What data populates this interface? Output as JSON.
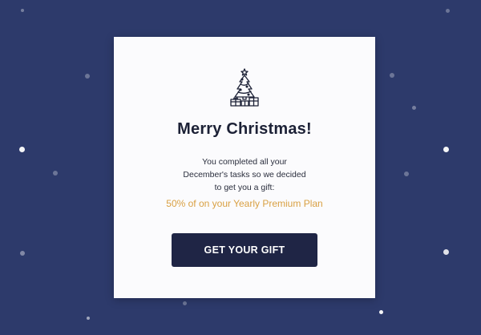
{
  "colors": {
    "background": "#2d3a6b",
    "card": "#fbfbfd",
    "title": "#1c2136",
    "accent": "#d9a043",
    "button": "#1f2545",
    "button_text": "#ffffff"
  },
  "modal": {
    "icon": "christmas-tree-icon",
    "title": "Merry Christmas!",
    "message_lines": [
      "You completed all your",
      "December's tasks so we decided",
      "to get you a gift:"
    ],
    "offer": "50% of on your Yearly Premium Plan",
    "button_label": "GET YOUR GIFT"
  }
}
